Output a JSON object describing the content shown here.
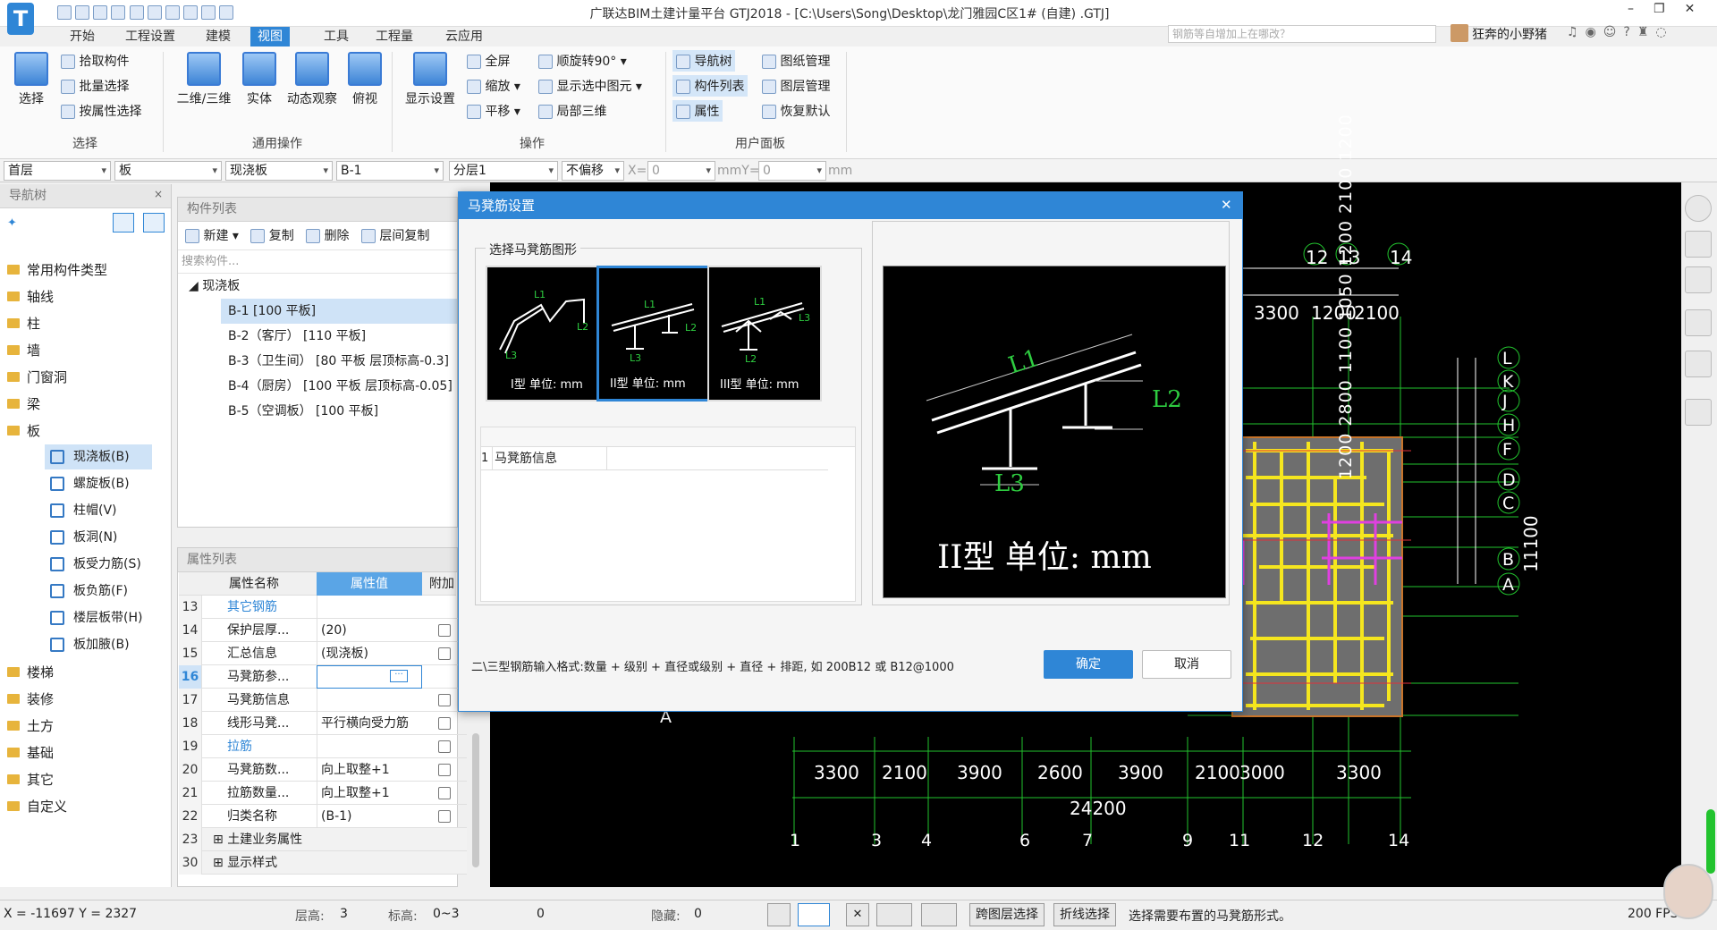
{
  "window": {
    "title": "广联达BIM土建计量平台 GTJ2018 - [C:\\Users\\Song\\Desktop\\龙门雅园C区1# (自建) .GTJ]",
    "search_placeholder": "钢筋等自增加上在哪改？",
    "user_name": "狂奔的小野猪"
  },
  "menu_tabs": [
    "开始",
    "工程设置",
    "建模",
    "视图",
    "工具",
    "工程量",
    "云应用"
  ],
  "ribbon": {
    "select_group": {
      "label": "选择",
      "big": "选择",
      "items": [
        "拾取构件",
        "批量选择",
        "按属性选择"
      ]
    },
    "common_group": {
      "label": "通用操作",
      "items": [
        "二维/三维",
        "实体",
        "动态观察",
        "俯视"
      ]
    },
    "ops_group": {
      "label": "操作",
      "display": "显示设置",
      "items": [
        "全屏",
        "缩放",
        "平移",
        "顺旋转90°",
        "显示选中图元",
        "局部三维"
      ]
    },
    "user_group": {
      "label": "用户面板",
      "items": [
        "导航树",
        "构件列表",
        "属性",
        "图纸管理",
        "图层管理",
        "恢复默认"
      ]
    }
  },
  "selector_bar": {
    "floor": "首层",
    "category": "板",
    "type": "现浇板",
    "component": "B-1",
    "layer": "分层1",
    "offset": "不偏移",
    "x_label": "X=",
    "x_value": "0",
    "y_label": "mmY=",
    "y_value": "0",
    "unit": "mm"
  },
  "nav_tree": {
    "title": "导航树",
    "categories": [
      "常用构件类型",
      "轴线",
      "柱",
      "墙",
      "门窗洞",
      "梁",
      "板"
    ],
    "slab_children": [
      "现浇板(B)",
      "螺旋板(B)",
      "柱帽(V)",
      "板洞(N)",
      "板受力筋(S)",
      "板负筋(F)",
      "楼层板带(H)",
      "板加腋(B)"
    ],
    "more_categories": [
      "楼梯",
      "装修",
      "土方",
      "基础",
      "其它",
      "自定义"
    ]
  },
  "component_list": {
    "title": "构件列表",
    "actions": [
      "新建",
      "复制",
      "删除",
      "层间复制"
    ],
    "search_placeholder": "搜索构件...",
    "group": "现浇板",
    "items": [
      "B-1 [100 平板]",
      "B-2（客厅） [110 平板]",
      "B-3（卫生间） [80 平板 层顶标高-0.3]",
      "B-4（厨房） [100 平板 层顶标高-0.05]",
      "B-5（空调板） [100 平板]"
    ]
  },
  "property_list": {
    "title": "属性列表",
    "headers": [
      "属性名称",
      "属性值",
      "附加"
    ],
    "rows": [
      {
        "n": "13",
        "name": "其它钢筋",
        "value": ""
      },
      {
        "n": "14",
        "name": "保护层厚...",
        "value": "(20)"
      },
      {
        "n": "15",
        "name": "汇总信息",
        "value": "(现浇板)"
      },
      {
        "n": "16",
        "name": "马凳筋参...",
        "value": ""
      },
      {
        "n": "17",
        "name": "马凳筋信息",
        "value": ""
      },
      {
        "n": "18",
        "name": "线形马凳...",
        "value": "平行横向受力筋"
      },
      {
        "n": "19",
        "name": "拉筋",
        "value": ""
      },
      {
        "n": "20",
        "name": "马凳筋数...",
        "value": "向上取整+1"
      },
      {
        "n": "21",
        "name": "拉筋数量...",
        "value": "向上取整+1"
      },
      {
        "n": "22",
        "name": "归类名称",
        "value": "(B-1)"
      },
      {
        "n": "23",
        "name": "土建业务属性",
        "value": ""
      },
      {
        "n": "30",
        "name": "显示样式",
        "value": ""
      }
    ]
  },
  "dialog": {
    "title": "马凳筋设置",
    "section_label": "选择马凳筋图形",
    "shapes": [
      "I型 单位: mm",
      "II型 单位: mm",
      "III型 单位: mm"
    ],
    "selected_shape": "II型",
    "table_row_num": "1",
    "table_row_label": "马凳筋信息",
    "preview_caption": "II型 单位: mm",
    "preview_labels": [
      "L1",
      "L2",
      "L3"
    ],
    "hint": "二\\三型钢筋输入格式:数量 + 级别 + 直径或级别 + 直径 + 排距, 如 200B12 或 B12@1000",
    "ok": "确定",
    "cancel": "取消"
  },
  "drawing": {
    "top_axes": [
      "12",
      "13",
      "14"
    ],
    "top_dims": [
      "3300",
      "1200",
      "2100"
    ],
    "right_axes": [
      "L",
      "K",
      "J",
      "H",
      "F",
      "D",
      "C",
      "B",
      "A"
    ],
    "right_dims": "1200 2800 1100 1050 1200 2100 1200",
    "right_total": "11100",
    "bottom_dims": [
      "3300",
      "2100",
      "3900",
      "2600",
      "3900",
      "2100",
      "3000",
      "3300"
    ],
    "bottom_total": "24200",
    "bottom_axes": [
      "1",
      "3",
      "4",
      "6",
      "7",
      "9",
      "11",
      "12",
      "14"
    ],
    "left_axis": "A"
  },
  "status": {
    "coords": "X = -11697 Y = 2327",
    "floor_height_label": "层高:",
    "floor_height": "3",
    "elevation_label": "标高:",
    "elevation": "0~3",
    "zero": "0",
    "hidden_label": "隐藏:",
    "hidden": "0",
    "btn_cross_layer": "跨图层选择",
    "btn_polyline": "折线选择",
    "hint": "选择需要布置的马凳筋形式。",
    "fps": "200 FPS"
  },
  "colors": {
    "accent": "#2f86d6",
    "drawing_bg": "#000000",
    "grid_green": "#22c32e",
    "rebar_yellow": "#f5e61e",
    "slab_gray": "#6e6e6e"
  }
}
